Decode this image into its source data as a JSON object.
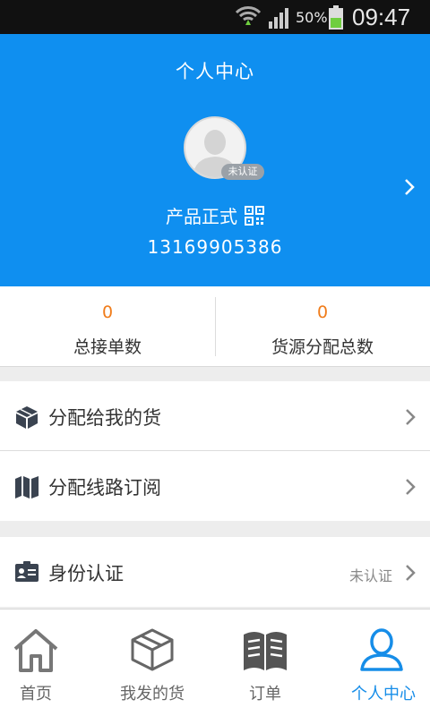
{
  "status_bar": {
    "battery_percent": "50%",
    "time": "09:47"
  },
  "header": {
    "title": "个人中心",
    "avatar_icon": "person-placeholder-icon",
    "cert_badge": "未认证",
    "user_name": "产品正式",
    "phone": "13169905386"
  },
  "stats": [
    {
      "value": "0",
      "label": "总接单数"
    },
    {
      "value": "0",
      "label": "货源分配总数"
    }
  ],
  "menu": {
    "group1": [
      {
        "label": "分配给我的货",
        "icon": "cube-icon"
      },
      {
        "label": "分配线路订阅",
        "icon": "map-icon"
      }
    ],
    "group2": [
      {
        "label": "身份认证",
        "value": "未认证",
        "icon": "id-card-icon"
      }
    ]
  },
  "nav": [
    {
      "label": "首页",
      "icon": "home-icon",
      "active": false
    },
    {
      "label": "我发的货",
      "icon": "box-icon",
      "active": false
    },
    {
      "label": "订单",
      "icon": "book-icon",
      "active": false
    },
    {
      "label": "个人中心",
      "icon": "user-icon",
      "active": true
    }
  ],
  "colors": {
    "accent": "#0f8ff0",
    "stat_value": "#f07c1a",
    "nav_active": "#168de8"
  }
}
